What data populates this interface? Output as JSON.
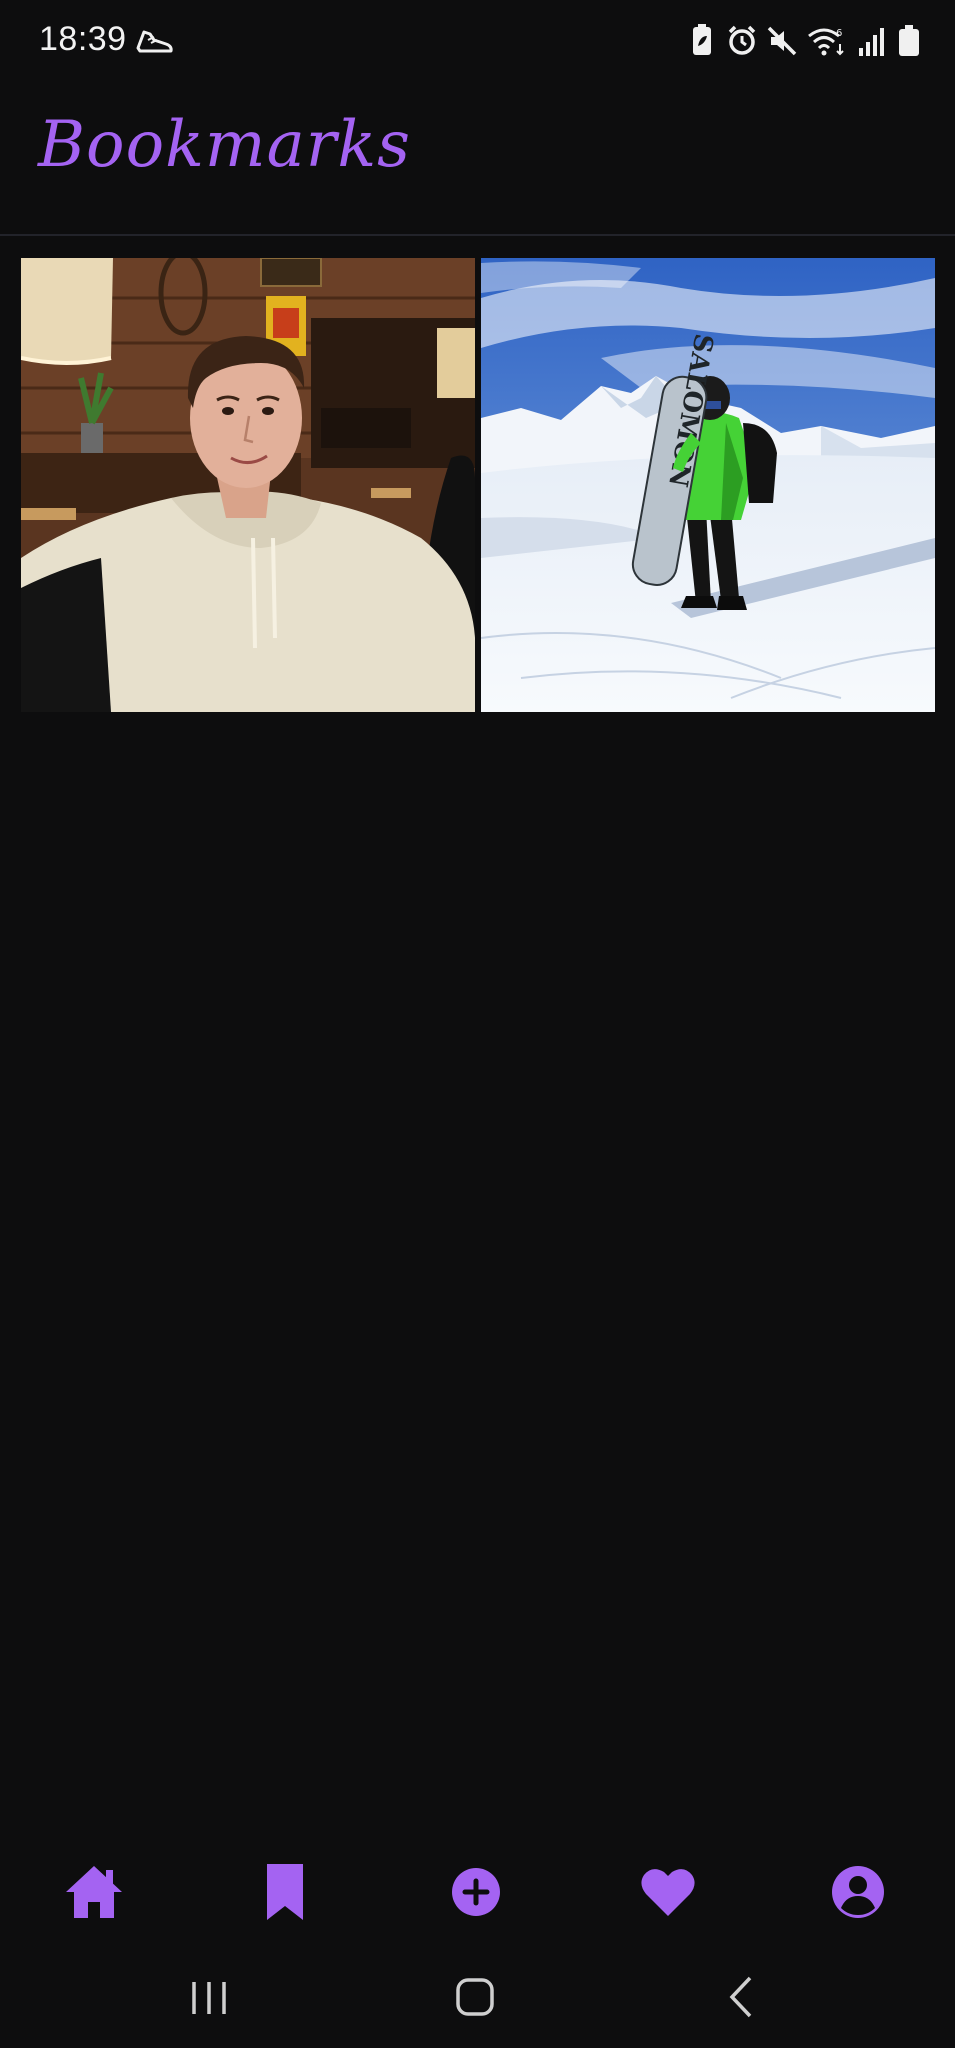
{
  "status_bar": {
    "time": "18:39",
    "left_icons": [
      "running-shoe-icon"
    ],
    "right_icons": [
      "battery-saver-icon",
      "alarm-icon",
      "mute-icon",
      "wifi-6-icon",
      "signal-icon",
      "battery-icon"
    ]
  },
  "header": {
    "title": "Bookmarks"
  },
  "bookmarks": [
    {
      "label": "",
      "scene": "restaurant-portrait"
    },
    {
      "label": "",
      "scene": "snowboard-mountain"
    }
  ],
  "snowboard_text": "SALOMON",
  "bottom_nav": {
    "items": [
      "home-icon",
      "bookmark-icon",
      "add-circle-icon",
      "heart-icon",
      "profile-icon"
    ],
    "active": "bookmark-icon"
  },
  "system_nav": [
    "recents-button",
    "home-button",
    "back-button"
  ],
  "colors": {
    "accent": "#a463f2",
    "background": "#0d0d0e",
    "divider": "#22232a"
  }
}
